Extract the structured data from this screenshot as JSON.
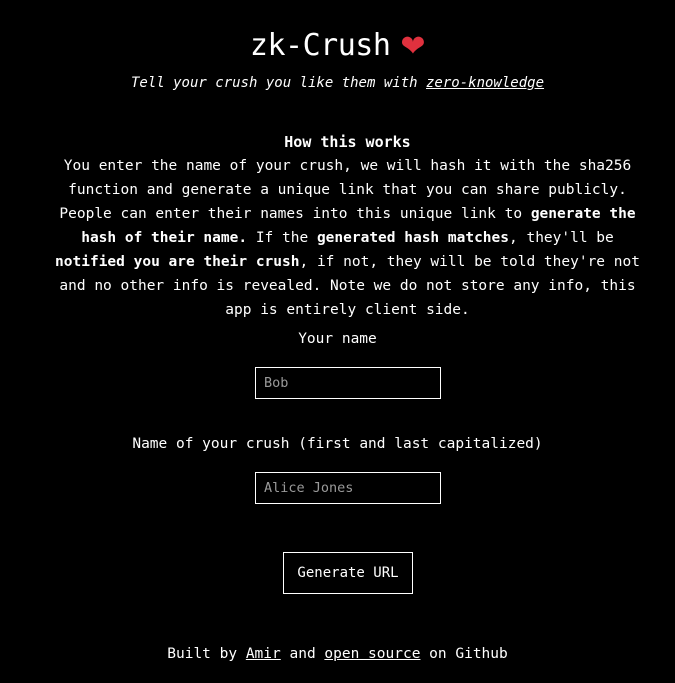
{
  "header": {
    "title": "zk-Crush",
    "heart_icon": "❤",
    "subtitle_prefix": "Tell your crush you like them with ",
    "subtitle_link": "zero-knowledge"
  },
  "how": {
    "title": "How this works",
    "p1": "You enter the name of your crush, we will hash it with the sha256 function and generate a unique link that you can share publicly. People can enter their names into this unique link to ",
    "b1": "generate the hash of their name.",
    "p2": " If the ",
    "b2": "generated hash matches",
    "p3": ", they'll be ",
    "b3": "notified you are their crush",
    "p4": ", if not, they will be told they're not and no other info is revealed. Note we do not store any info, this app is entirely client side."
  },
  "form": {
    "name_label": "Your name",
    "name_placeholder": "Bob",
    "crush_label": "Name of your crush (first and last capitalized)",
    "crush_placeholder": "Alice Jones",
    "button_label": "Generate URL"
  },
  "footer": {
    "prefix": "Built by ",
    "author_link": "Amir",
    "middle": " and ",
    "source_link": "open source",
    "suffix": " on Github"
  },
  "colors": {
    "background": "#000000",
    "text": "#ffffff",
    "heart": "#e0313e"
  }
}
